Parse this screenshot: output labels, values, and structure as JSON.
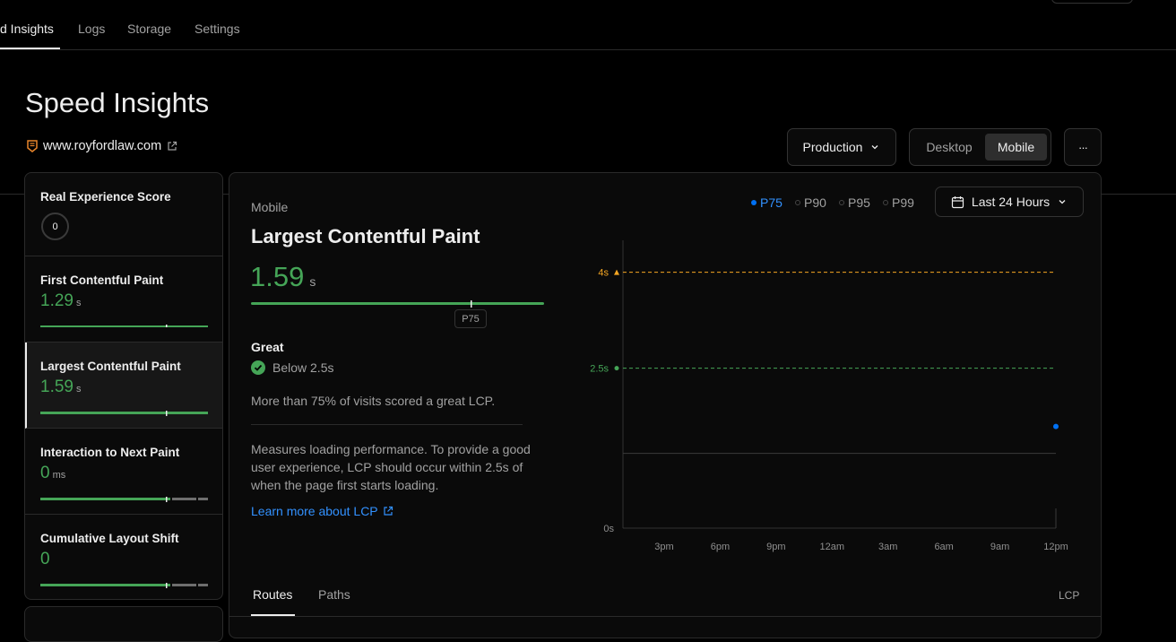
{
  "nav": {
    "tabs": [
      {
        "label": "d Insights"
      },
      {
        "label": "Logs"
      },
      {
        "label": "Storage"
      },
      {
        "label": "Settings"
      }
    ]
  },
  "page": {
    "title": "Speed Insights",
    "site": "www.royfordlaw.com"
  },
  "controls": {
    "environment": "Production",
    "device_options": [
      "Desktop",
      "Mobile"
    ],
    "selected_device": "Mobile",
    "more_label": "···",
    "date_range": "Last 24 Hours",
    "percentiles": [
      "P75",
      "P90",
      "P95",
      "P99"
    ],
    "selected_percentile": "P75"
  },
  "sidebar": {
    "res_label": "Real Experience Score",
    "res_value": "0",
    "metrics": [
      {
        "name": "First Contentful Paint",
        "value": "1.29",
        "unit": "s"
      },
      {
        "name": "Largest Contentful Paint",
        "value": "1.59",
        "unit": "s"
      },
      {
        "name": "Interaction to Next Paint",
        "value": "0",
        "unit": "ms"
      },
      {
        "name": "Cumulative Layout Shift",
        "value": "0",
        "unit": ""
      }
    ]
  },
  "detail": {
    "device": "Mobile",
    "metric_title": "Largest Contentful Paint",
    "value": "1.59",
    "unit": "s",
    "marker_label": "P75",
    "rating": "Great",
    "threshold_text": "Below 2.5s",
    "summary": "More than 75% of visits scored a great LCP.",
    "description": "Measures loading performance. To provide a good user experience, LCP should occur within 2.5s of when the page first starts loading.",
    "learn_more": "Learn more about LCP"
  },
  "chart_data": {
    "type": "line",
    "x_ticks": [
      "3pm",
      "6pm",
      "9pm",
      "12am",
      "3am",
      "6am",
      "9am",
      "12pm"
    ],
    "y_ticks": [
      "0s",
      "2.5s",
      "4s"
    ],
    "thresholds": [
      {
        "label": "4s",
        "value": 4,
        "color": "#f5a623"
      },
      {
        "label": "2.5s",
        "value": 2.5,
        "color": "#45a557"
      }
    ],
    "series": [
      {
        "values": [
          {
            "x": "12pm",
            "y": 1.59
          }
        ]
      }
    ],
    "ylim": [
      0,
      4.5
    ]
  },
  "routes": {
    "tabs": [
      "Routes",
      "Paths"
    ],
    "right_label": "LCP"
  },
  "colors": {
    "good": "#45a557",
    "needs_improvement": "#f5a623",
    "accent": "#0070f3"
  }
}
